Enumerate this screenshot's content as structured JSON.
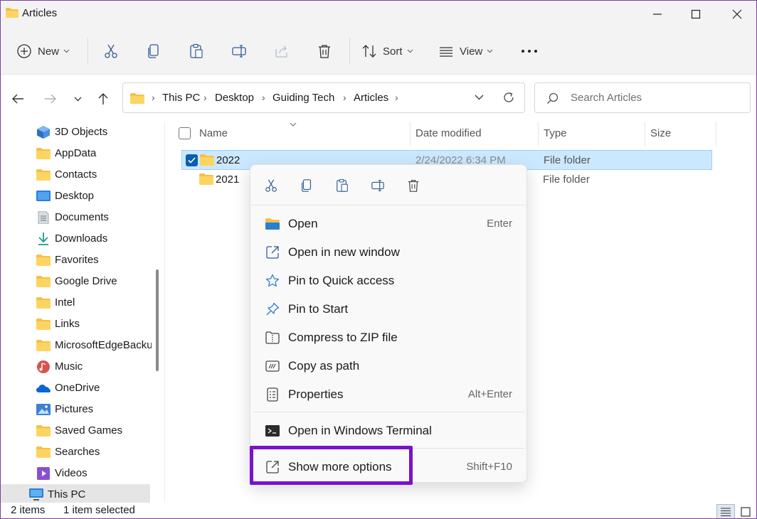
{
  "window": {
    "title": "Articles",
    "accent": "#7a12cc"
  },
  "commandbar": {
    "new_label": "New",
    "sort_label": "Sort",
    "view_label": "View"
  },
  "address": {
    "crumbs": [
      "This PC",
      "Desktop",
      "Guiding Tech",
      "Articles"
    ],
    "search_placeholder": "Search Articles"
  },
  "sidebar": {
    "items": [
      {
        "label": "3D Objects",
        "icon": "3d-objects-icon"
      },
      {
        "label": "AppData",
        "icon": "folder-icon"
      },
      {
        "label": "Contacts",
        "icon": "folder-icon"
      },
      {
        "label": "Desktop",
        "icon": "desktop-icon"
      },
      {
        "label": "Documents",
        "icon": "documents-icon"
      },
      {
        "label": "Downloads",
        "icon": "downloads-icon"
      },
      {
        "label": "Favorites",
        "icon": "folder-icon"
      },
      {
        "label": "Google Drive",
        "icon": "folder-icon"
      },
      {
        "label": "Intel",
        "icon": "folder-icon"
      },
      {
        "label": "Links",
        "icon": "folder-icon"
      },
      {
        "label": "MicrosoftEdgeBackups",
        "icon": "folder-icon"
      },
      {
        "label": "Music",
        "icon": "music-icon"
      },
      {
        "label": "OneDrive",
        "icon": "onedrive-icon"
      },
      {
        "label": "Pictures",
        "icon": "pictures-icon"
      },
      {
        "label": "Saved Games",
        "icon": "folder-icon"
      },
      {
        "label": "Searches",
        "icon": "folder-icon"
      },
      {
        "label": "Videos",
        "icon": "videos-icon"
      },
      {
        "label": "This PC",
        "icon": "this-pc-icon"
      }
    ]
  },
  "filelist": {
    "columns": [
      "Name",
      "Date modified",
      "Type",
      "Size"
    ],
    "rows": [
      {
        "name": "2022",
        "date": "2/24/2022 6:34 PM",
        "type": "File folder",
        "selected": true
      },
      {
        "name": "2021",
        "date": "",
        "type": "File folder",
        "selected": false
      }
    ]
  },
  "status": {
    "items": "2 items",
    "selected": "1 item selected"
  },
  "contextmenu": {
    "items": [
      {
        "label": "Open",
        "shortcut": "Enter"
      },
      {
        "label": "Open in new window",
        "shortcut": ""
      },
      {
        "label": "Pin to Quick access",
        "shortcut": ""
      },
      {
        "label": "Pin to Start",
        "shortcut": ""
      },
      {
        "label": "Compress to ZIP file",
        "shortcut": ""
      },
      {
        "label": "Copy as path",
        "shortcut": ""
      },
      {
        "label": "Properties",
        "shortcut": "Alt+Enter"
      },
      {
        "label": "Open in Windows Terminal",
        "shortcut": ""
      },
      {
        "label": "Show more options",
        "shortcut": "Shift+F10"
      }
    ]
  }
}
